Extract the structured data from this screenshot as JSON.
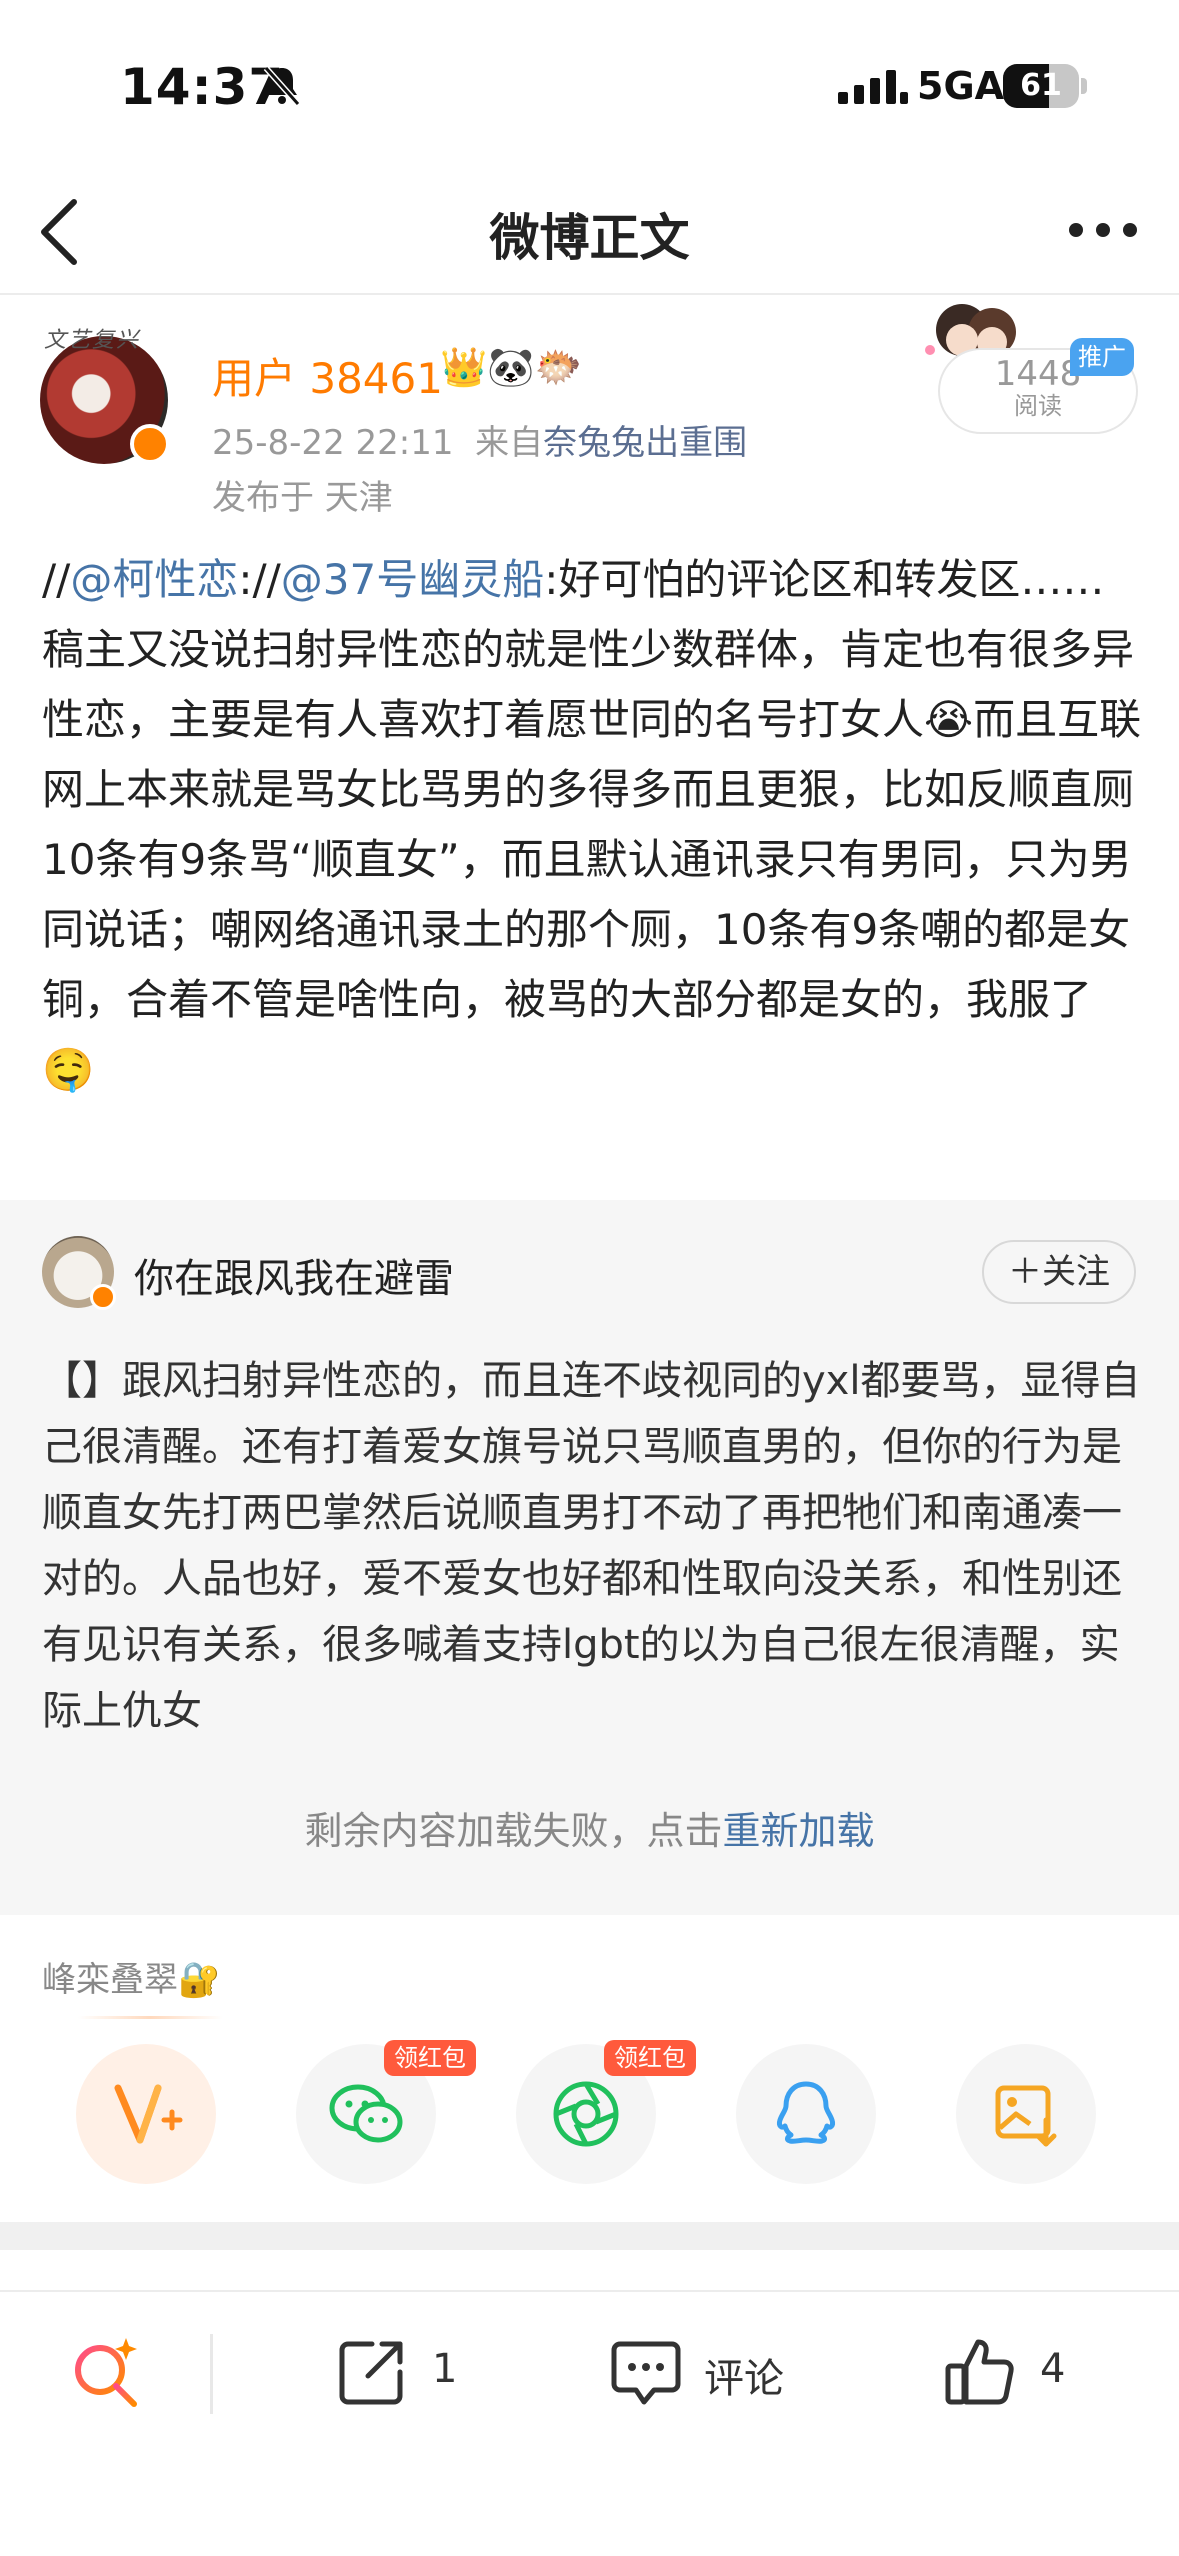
{
  "status_bar": {
    "time": "14:37",
    "network": "5GA",
    "battery": "61",
    "battery_level": 0.61
  },
  "nav": {
    "title": "微博正文"
  },
  "post": {
    "avatar_tag": "文艺复兴",
    "username": "用户 38461",
    "badges": "👑🐼🐡",
    "datetime": "25-8-22 22:11",
    "source_prefix": "来自",
    "source": "奈兔兔出重围",
    "location": "发布于 天津",
    "reads": "1448",
    "reads_label": "阅读",
    "ad_label": "推广",
    "text_prefix": "//",
    "mention1": "@柯性恋",
    "text_mid": "://",
    "mention2": "@37号幽灵船",
    "text_body": ":好可怕的评论区和转发区……稿主又没说扫射异性恋的就是性少数群体，肯定也有很多异性恋，主要是有人喜欢打着愿世同的名号打女人😭而且互联网上本来就是骂女比骂男的多得多而且更狠，比如反顺直厕10条有9条骂“顺直女”，而且默认通讯录只有男同，只为男同说话；嘲网络通讯录土的那个厕，10条有9条嘲的都是女铜，合着不管是啥性向，被骂的大部分都是女的，我服了🤤"
  },
  "original": {
    "author": "你在跟风我在避雷",
    "follow_label": "＋关注",
    "text": "【】跟风扫射异性恋的，而且连不歧视同的yxl都要骂，显得自己很清醒。还有打着爱女旗号说只骂顺直男的，但你的行为是顺直女先打两巴掌然后说顺直男打不动了再把牠们和南通凑一对的。人品也好，爱不爱女也好都和性取向没关系，和性别还有见识有关系，很多喊着支持lgbt的以为自己很左很清醒，实际上仇女",
    "fail_text": "剩余内容加载失败，点击",
    "reload_label": "重新加载"
  },
  "share": {
    "hint": "峰栾叠翠🔐",
    "red_packet_label": "领红包",
    "icons": [
      "vplus-icon",
      "wechat-icon",
      "moments-icon",
      "qq-icon",
      "save-image-icon"
    ]
  },
  "toolbar": {
    "repost_count": "1",
    "comment_label": "评论",
    "like_count": "4"
  },
  "colors": {
    "accent": "#ff8200",
    "link": "#4674a7",
    "wechat": "#20c05c",
    "qq": "#3aa0f0",
    "save": "#f5a623",
    "search_gradient": [
      "#ff4b8b",
      "#ff8a00"
    ]
  }
}
